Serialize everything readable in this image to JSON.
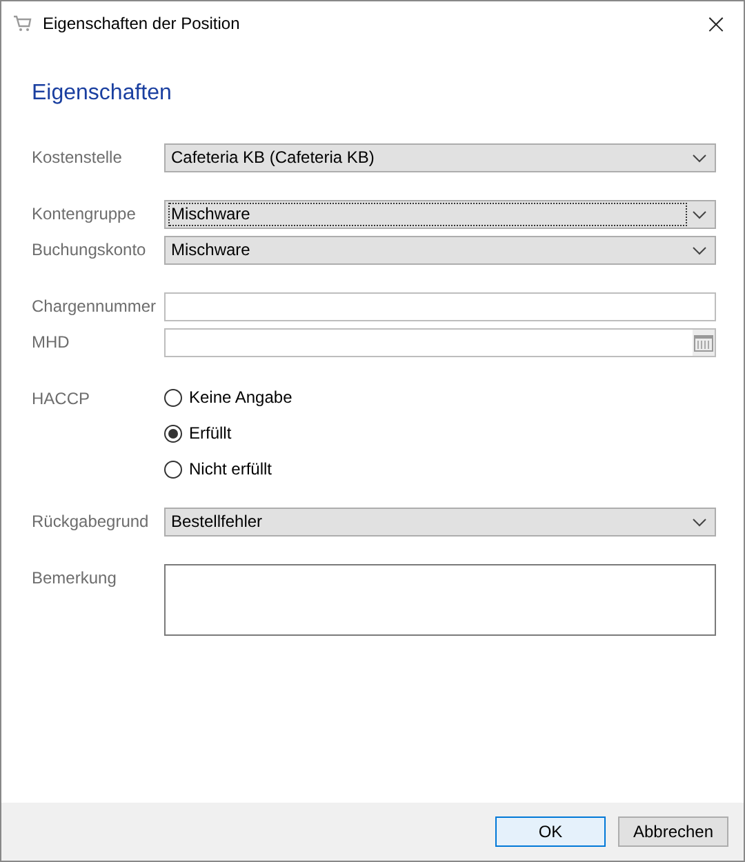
{
  "window": {
    "title": "Eigenschaften der Position",
    "close": "×"
  },
  "heading": "Eigenschaften",
  "sections": [
    {
      "fields": [
        {
          "kind": "combo",
          "label": "Kostenstelle",
          "value": "Cafeteria KB (Cafeteria KB)",
          "focused": false
        }
      ]
    },
    {
      "fields": [
        {
          "kind": "combo",
          "label": "Kontengruppe",
          "value": "Mischware",
          "focused": true
        },
        {
          "kind": "combo",
          "label": "Buchungskonto",
          "value": "Mischware",
          "focused": false
        }
      ]
    },
    {
      "fields": [
        {
          "kind": "text",
          "label": "Chargennummer"
        },
        {
          "kind": "date",
          "label": "MHD"
        }
      ]
    },
    {
      "fields": [
        {
          "kind": "radio",
          "label": "HACCP",
          "options": [
            {
              "label": "Keine Angabe",
              "selected": false
            },
            {
              "label": "Erfüllt",
              "selected": true
            },
            {
              "label": "Nicht erfüllt",
              "selected": false
            }
          ]
        }
      ]
    },
    {
      "fields": [
        {
          "kind": "combo",
          "label": "Rückgabegrund",
          "value": "Bestellfehler",
          "focused": false
        }
      ]
    },
    {
      "fields": [
        {
          "kind": "textarea",
          "label": "Bemerkung"
        }
      ]
    }
  ],
  "buttons": [
    {
      "label": "OK",
      "default": true
    },
    {
      "label": "Abbrechen",
      "default": false
    }
  ]
}
